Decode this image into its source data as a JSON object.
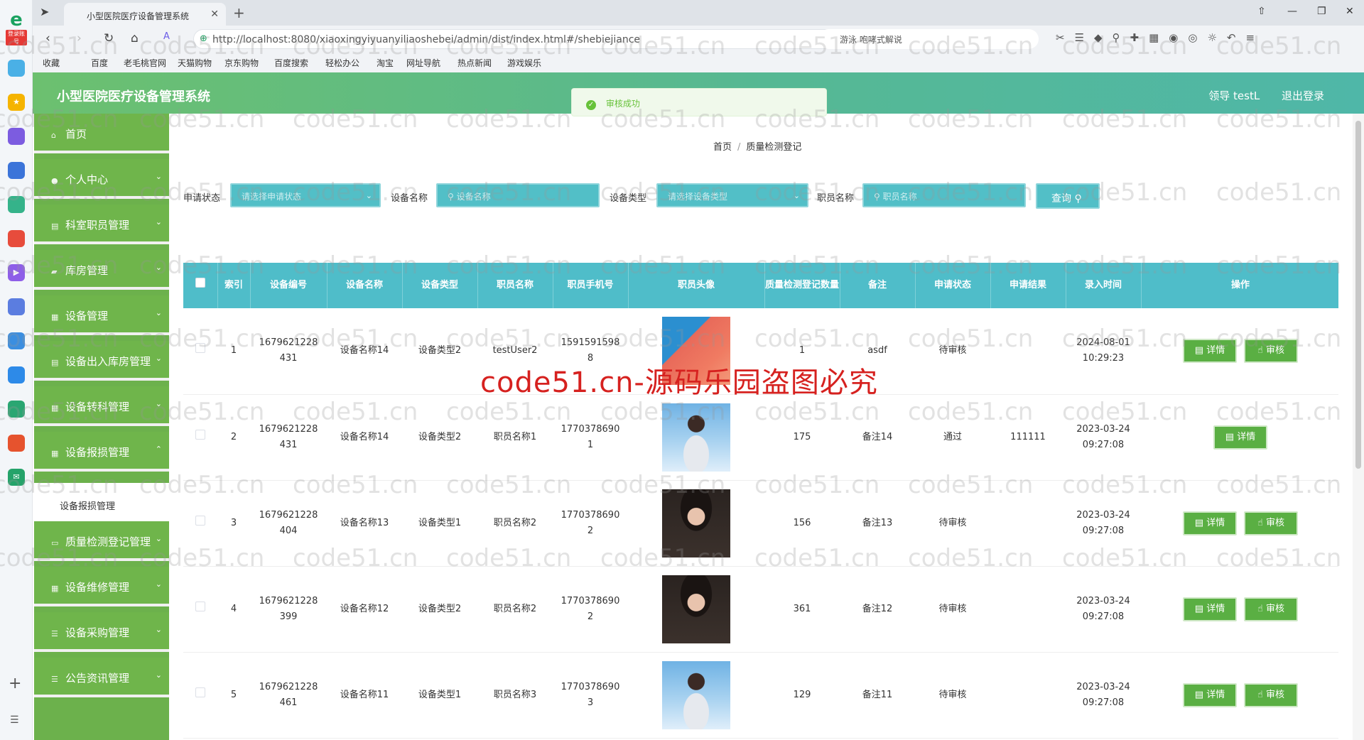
{
  "browser": {
    "tab_title": "小型医院医疗设备管理系统",
    "url": "http://localhost:8080/xiaoxingyiyuanyiliaoshebei/admin/dist/index.html#/shebiejiance",
    "search_placeholder": "游泳 咆哮式解说",
    "bookmarks": [
      "收藏",
      "百度",
      "老毛桃官网",
      "天猫购物",
      "京东购物",
      "百度搜索",
      "轻松办公",
      "淘宝",
      "网址导航",
      "热点新闻",
      "游戏娱乐"
    ],
    "rail_tag": "登录账号"
  },
  "header": {
    "title": "小型医院医疗设备管理系统",
    "user": "领导 testL",
    "logout": "退出登录"
  },
  "toast": {
    "message": "审核成功"
  },
  "sidebar": {
    "items": [
      {
        "label": "首页",
        "icon": "home-icon"
      },
      {
        "label": "个人中心",
        "icon": "user-icon"
      },
      {
        "label": "科室职员管理",
        "icon": "doc-icon"
      },
      {
        "label": "库房管理",
        "icon": "warehouse-icon"
      },
      {
        "label": "设备管理",
        "icon": "grid-icon"
      },
      {
        "label": "设备出入库房管理",
        "icon": "doc-icon"
      },
      {
        "label": "设备转科管理",
        "icon": "grid-icon"
      },
      {
        "label": "设备报损管理",
        "icon": "grid-icon"
      },
      {
        "label": "质量检测登记管理",
        "icon": "monitor-icon"
      },
      {
        "label": "设备维修管理",
        "icon": "grid-icon"
      },
      {
        "label": "设备采购管理",
        "icon": "list-icon"
      },
      {
        "label": "公告资讯管理",
        "icon": "list-icon"
      }
    ],
    "submenu_label": "设备报损管理"
  },
  "breadcrumb": {
    "home": "首页",
    "current": "质量检测登记"
  },
  "search": {
    "status_label": "申请状态",
    "status_placeholder": "请选择申请状态",
    "name_label": "设备名称",
    "name_placeholder": "设备名称",
    "type_label": "设备类型",
    "type_placeholder": "请选择设备类型",
    "staff_label": "职员名称",
    "staff_placeholder": "职员名称",
    "query_button": "查询"
  },
  "table": {
    "headers": [
      "索引",
      "设备编号",
      "设备名称",
      "设备类型",
      "职员名称",
      "职员手机号",
      "职员头像",
      "质量检测登记数量",
      "备注",
      "申请状态",
      "申请结果",
      "录入时间",
      "操作"
    ],
    "detail_label": "详情",
    "audit_label": "审核",
    "rows": [
      {
        "index": "1",
        "code": "1679621228431",
        "name": "设备名称14",
        "type": "设备类型2",
        "staff": "testUser2",
        "phone": "15915915988",
        "avatar": "av1",
        "count": "1",
        "note": "asdf",
        "status": "待审核",
        "result": "",
        "time": "2024-08-01 10:29:23",
        "audit": true
      },
      {
        "index": "2",
        "code": "1679621228431",
        "name": "设备名称14",
        "type": "设备类型2",
        "staff": "职员名称1",
        "phone": "17703786901",
        "avatar": "av2",
        "count": "175",
        "note": "备注14",
        "status": "通过",
        "result": "111111",
        "time": "2023-03-24 09:27:08",
        "audit": false
      },
      {
        "index": "3",
        "code": "1679621228404",
        "name": "设备名称13",
        "type": "设备类型1",
        "staff": "职员名称2",
        "phone": "17703786902",
        "avatar": "av3",
        "count": "156",
        "note": "备注13",
        "status": "待审核",
        "result": "",
        "time": "2023-03-24 09:27:08",
        "audit": true
      },
      {
        "index": "4",
        "code": "1679621228399",
        "name": "设备名称12",
        "type": "设备类型2",
        "staff": "职员名称2",
        "phone": "17703786902",
        "avatar": "av3",
        "count": "361",
        "note": "备注12",
        "status": "待审核",
        "result": "",
        "time": "2023-03-24 09:27:08",
        "audit": true
      },
      {
        "index": "5",
        "code": "1679621228461",
        "name": "设备名称11",
        "type": "设备类型1",
        "staff": "职员名称3",
        "phone": "17703786903",
        "avatar": "av2",
        "count": "129",
        "note": "备注11",
        "status": "待审核",
        "result": "",
        "time": "2023-03-24 09:27:08",
        "audit": true
      }
    ]
  },
  "watermark": {
    "small": "code51.cn",
    "big": "code51.cn-源码乐园盗图必究"
  }
}
